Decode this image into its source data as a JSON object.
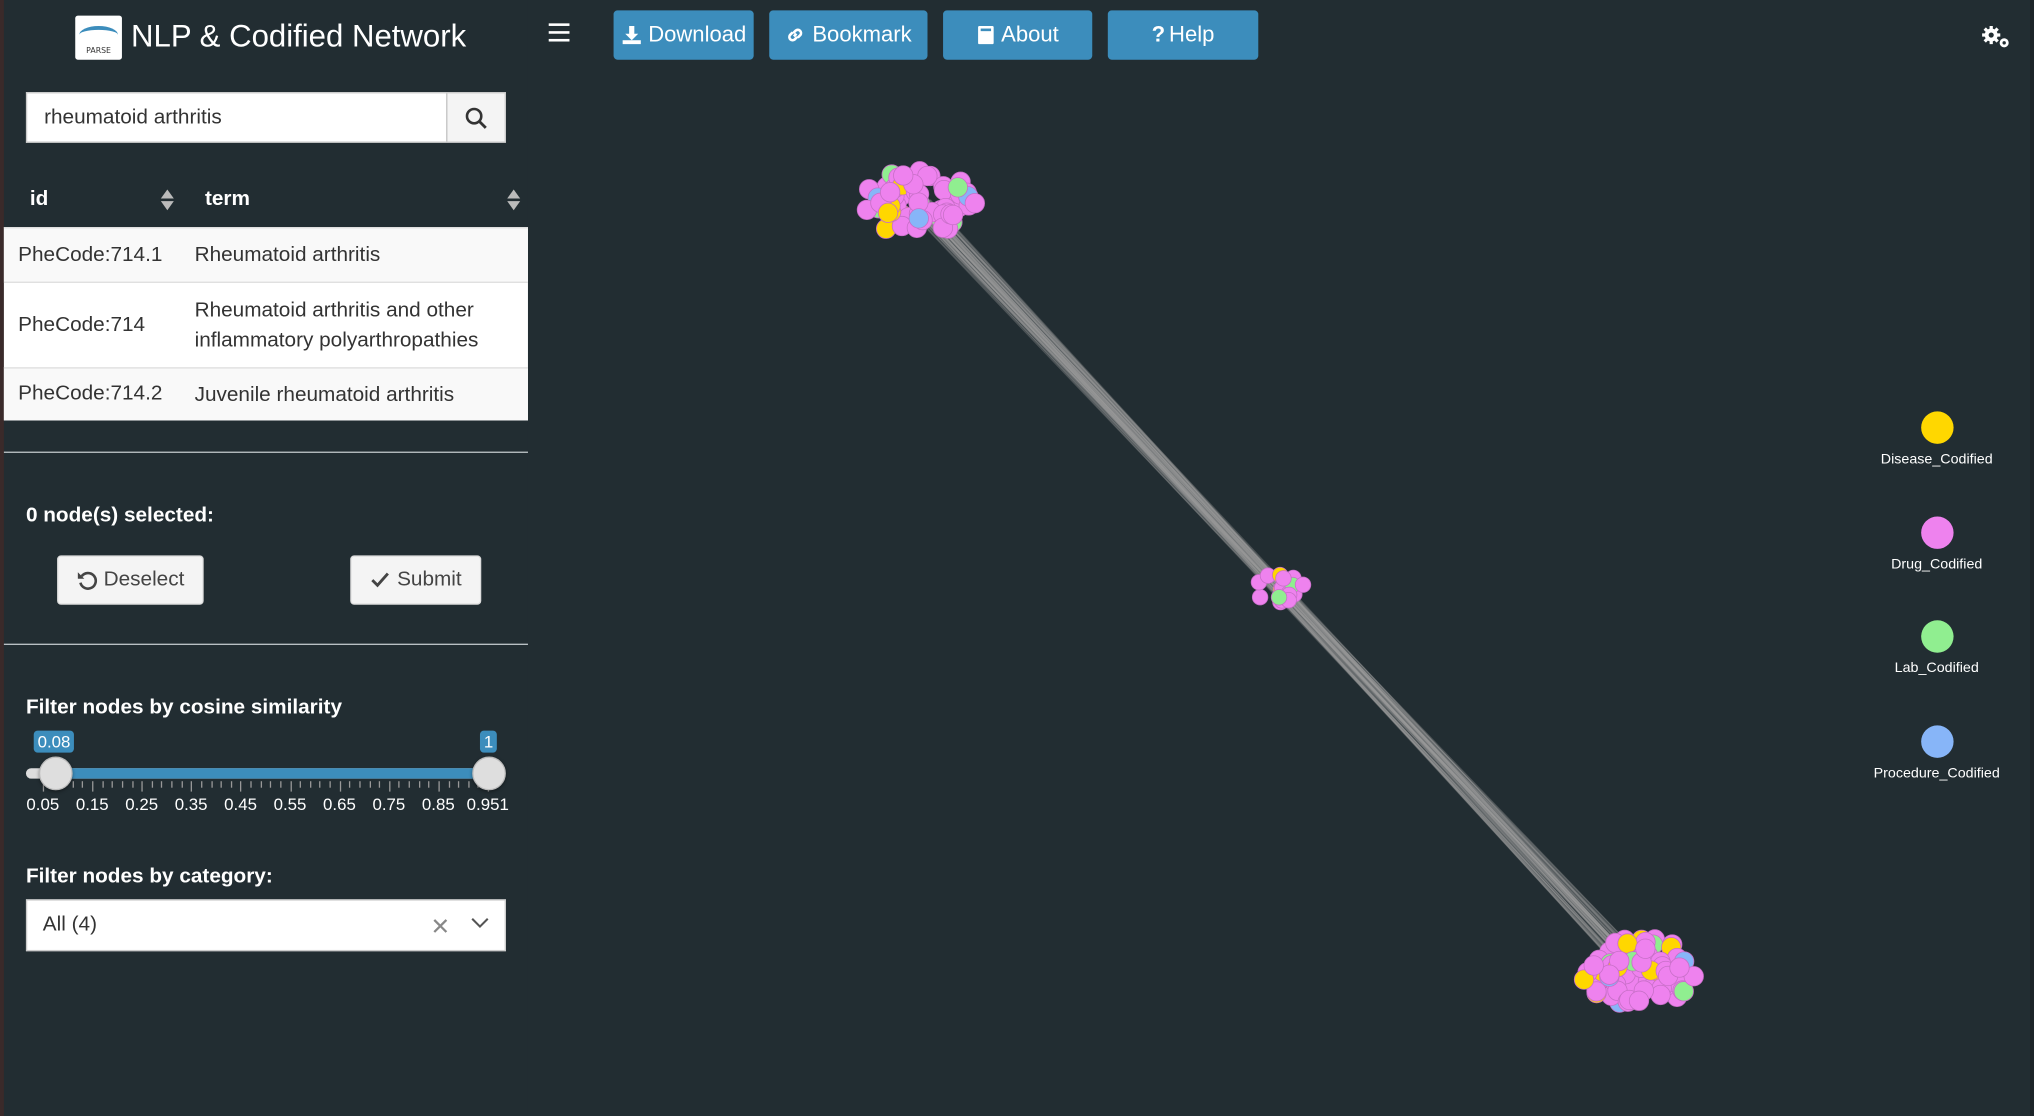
{
  "header": {
    "app_title": "NLP & Codified Network",
    "logo_text": "PARSE",
    "buttons": {
      "download": "Download",
      "bookmark": "Bookmark",
      "about": "About",
      "help": "Help"
    }
  },
  "search": {
    "value": "rheumatoid arthritis"
  },
  "table": {
    "columns": [
      "id",
      "term"
    ],
    "rows": [
      {
        "id": "PheCode:714.1",
        "term": "Rheumatoid arthritis"
      },
      {
        "id": "PheCode:714",
        "term": "Rheumatoid arthritis and other inflammatory polyarthropathies"
      },
      {
        "id": "PheCode:714.2",
        "term": "Juvenile rheumatoid arthritis"
      }
    ]
  },
  "selection": {
    "label": "0 node(s) selected:",
    "deselect": "Deselect",
    "submit": "Submit"
  },
  "filter_similarity": {
    "label": "Filter nodes by cosine similarity",
    "min_value": "0.08",
    "max_value": "1",
    "range_min": 0.05,
    "range_max": 1,
    "tick_labels": [
      "0.05",
      "0.15",
      "0.25",
      "0.35",
      "0.45",
      "0.55",
      "0.65",
      "0.75",
      "0.85",
      "0.951"
    ]
  },
  "filter_category": {
    "label": "Filter nodes by category:",
    "selected": "All (4)"
  },
  "legend": [
    {
      "label": "Disease_Codified",
      "color": "#ffd700"
    },
    {
      "label": "Drug_Codified",
      "color": "#ee82ee"
    },
    {
      "label": "Lab_Codified",
      "color": "#90ee90"
    },
    {
      "label": "Procedure_Codified",
      "color": "#87b5f8"
    }
  ]
}
